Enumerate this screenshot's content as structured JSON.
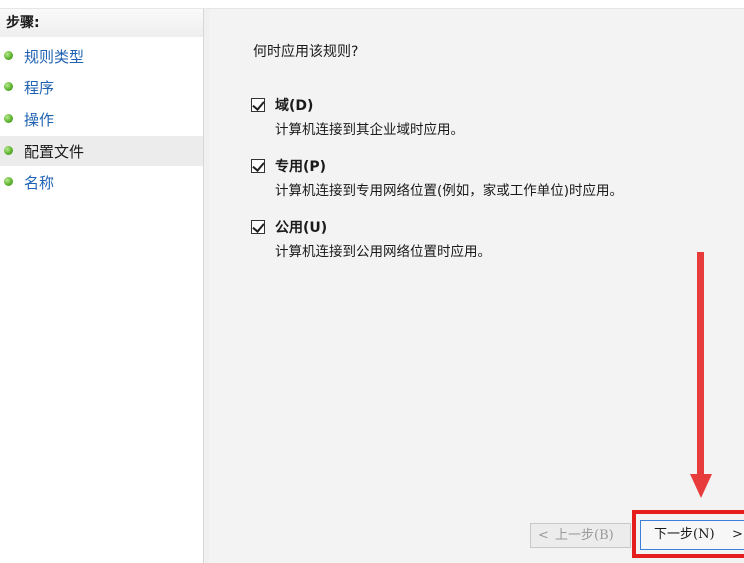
{
  "sidebar": {
    "header": "步骤:",
    "items": [
      {
        "label": "规则类型"
      },
      {
        "label": "程序"
      },
      {
        "label": "操作"
      },
      {
        "label": "配置文件",
        "active": true
      },
      {
        "label": "名称"
      }
    ]
  },
  "content": {
    "question": "何时应用该规则?",
    "options": [
      {
        "title": "域(D)",
        "description": "计算机连接到其企业域时应用。",
        "checked": true
      },
      {
        "title": "专用(P)",
        "description": "计算机连接到专用网络位置(例如，家或工作单位)时应用。",
        "checked": true
      },
      {
        "title": "公用(U)",
        "description": "计算机连接到公用网络位置时应用。",
        "checked": true
      }
    ]
  },
  "buttons": {
    "back_chevron": "<",
    "back_label": "上一步(B)",
    "next_label": "下一步(N)",
    "next_chevron": ">"
  },
  "colors": {
    "link": "#1f62b3",
    "annotation_red": "#e83c3c",
    "focus_blue": "#3c7fd6",
    "bullet_green": "#5fb330"
  }
}
